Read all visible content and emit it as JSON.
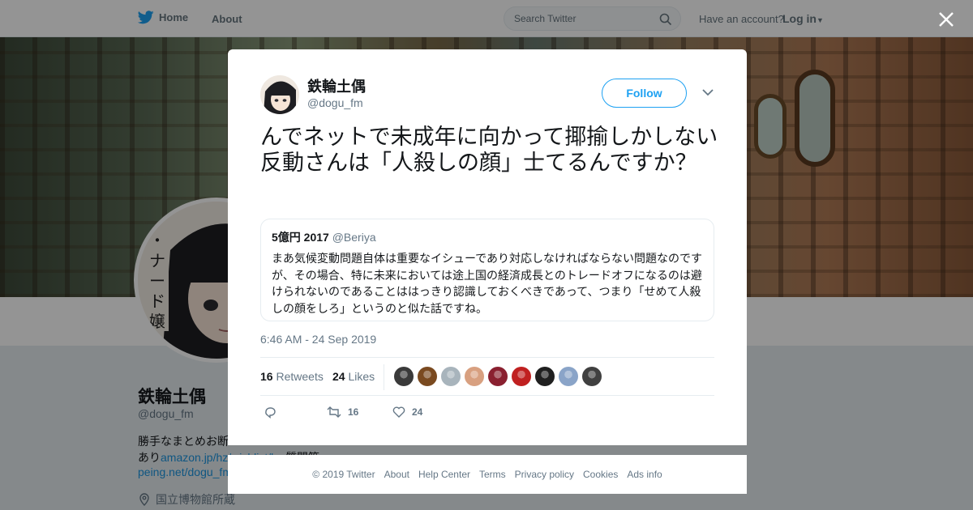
{
  "nav": {
    "home_label": "Home",
    "about_label": "About",
    "search_placeholder": "Search Twitter",
    "have_account": "Have an account?",
    "login_label": "Log in"
  },
  "profile": {
    "name": "鉄輪土偶",
    "handle": "@dogu_fm",
    "bio_line1": "勝手なまとめお断",
    "bio_line2_prefix": "あり",
    "bio_link1": "amazon.jp/hz/wishlist/ls",
    "bio_link1_suffix": "質問箱",
    "bio_link2": "peing.net/dogu_fm",
    "location": "国立博物館所蔵"
  },
  "tweet": {
    "author_name": "鉄輪土偶",
    "author_handle": "@dogu_fm",
    "follow_label": "Follow",
    "text": "んでネットで未成年に向かって揶揄しかしない反動さんは「人殺しの顔」士てるんですか？",
    "quote": {
      "name": "5億円 2017",
      "handle": "@Beriya",
      "text": "まあ気候変動問題自体は重要なイシューであり対応しなければならない問題なのですが、その場合、特に未来においては途上国の経済成長とのトレードオフになるのは避けられないのであることははっきり認識しておくべきであって、つまり「せめて人殺しの顔をしろ」というのと似た話ですね。"
    },
    "timestamp": "6:46 AM - 24 Sep 2019",
    "retweets_count": "16",
    "retweets_label": "Retweets",
    "likes_count": "24",
    "likes_label": "Likes",
    "action_retweet_count": "16",
    "action_like_count": "24",
    "liker_colors": [
      "#3a3a3a",
      "#7a4a20",
      "#a8b4bc",
      "#d8a080",
      "#8a2030",
      "#c02020",
      "#202020",
      "#8aa4c8",
      "#404040"
    ]
  },
  "footer": {
    "links": [
      "© 2019 Twitter",
      "About",
      "Help Center",
      "Terms",
      "Privacy policy",
      "Cookies",
      "Ads info"
    ]
  },
  "colors": {
    "brand": "#1da1f2",
    "link": "#1b95e0",
    "muted": "#657786"
  }
}
